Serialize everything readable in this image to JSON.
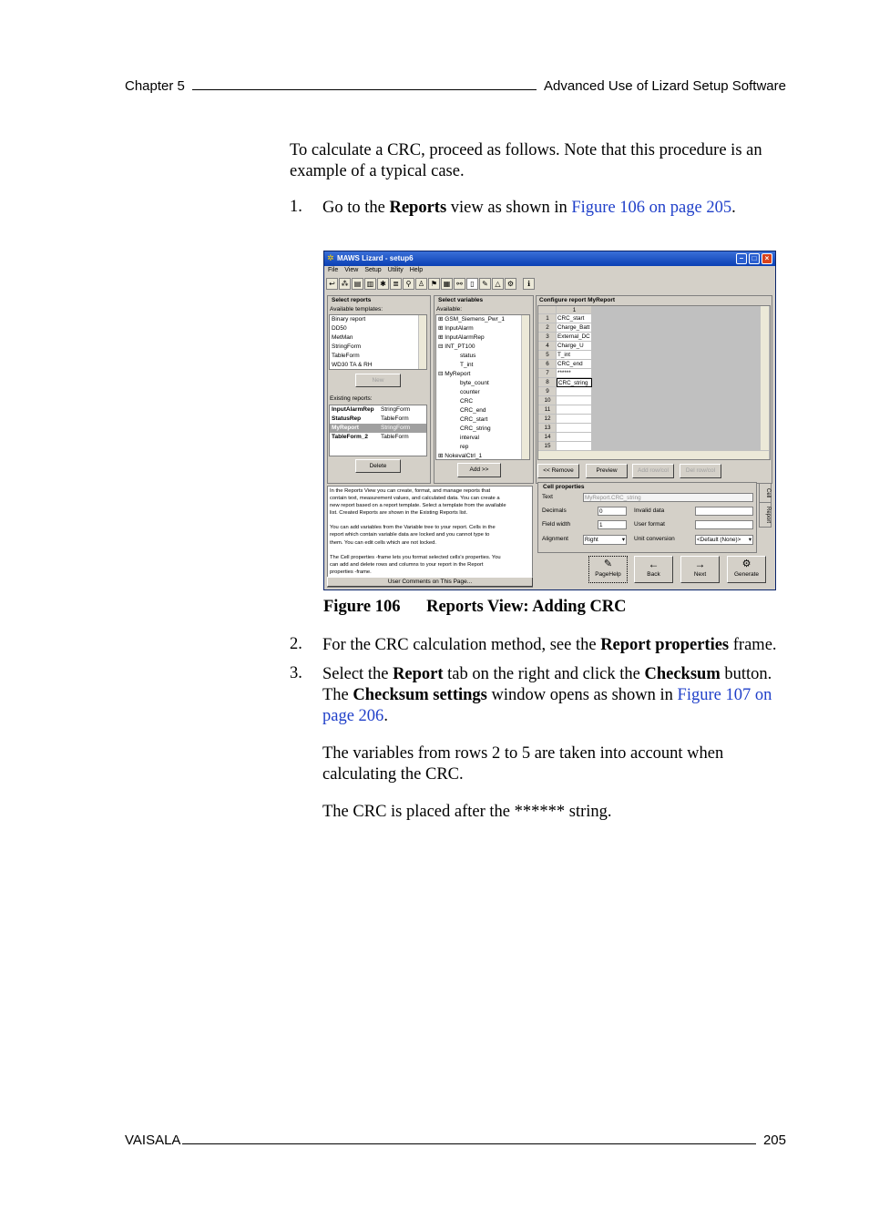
{
  "header": {
    "chapter": "Chapter 5",
    "section": "Advanced Use of Lizard Setup Software"
  },
  "intro": "To calculate a CRC, proceed as follows. Note that this procedure is an example of a typical case.",
  "step1": {
    "num": "1.",
    "pre": "Go to the ",
    "bold": "Reports",
    "mid": " view as shown in ",
    "link": "Figure 106 on page 205",
    "post": "."
  },
  "figure": {
    "window_title": "MAWS Lizard - setup6",
    "menu": [
      "File",
      "View",
      "Setup",
      "Utility",
      "Help"
    ],
    "select_reports": {
      "heading": "Select reports",
      "templates_label": "Available templates:",
      "templates": [
        "Binary report",
        "DD50",
        "MetMan",
        "StringForm",
        "TableForm",
        "WD30 TA & RH"
      ],
      "new_button": "New",
      "existing_label": "Existing reports:",
      "existing": [
        {
          "name": "InputAlarmRep",
          "type": "StringForm"
        },
        {
          "name": "StatusRep",
          "type": "TableForm"
        },
        {
          "name": "MyReport",
          "type": "StringForm"
        },
        {
          "name": "TableForm_2",
          "type": "TableForm"
        }
      ],
      "delete_button": "Delete"
    },
    "select_variables": {
      "heading": "Select variables",
      "available_label": "Available:",
      "tree": [
        "GSM_Siemens_Pwr_1",
        "InputAlarm",
        "InputAlarmRep",
        "INT_PT100",
        "status",
        "T_int",
        "MyReport",
        "byte_count",
        "counter",
        "CRC",
        "CRC_end",
        "CRC_start",
        "CRC_string",
        "interval",
        "rep",
        "NokevalCtrl_1"
      ],
      "add_button": "Add >>"
    },
    "configure": {
      "heading": "Configure report MyReport",
      "col_header": "1",
      "rows": [
        "1",
        "2",
        "3",
        "4",
        "5",
        "6",
        "7",
        "8",
        "9",
        "10",
        "11",
        "12",
        "13",
        "14",
        "15"
      ],
      "cells": [
        "CRC_start",
        "Charge_Batt",
        "External_DC",
        "Charge_U",
        "T_int",
        "CRC_end",
        "******",
        "CRC_string",
        "",
        "",
        "",
        "",
        "",
        "",
        ""
      ],
      "buttons": [
        "<< Remove",
        "Preview",
        "Add row/col",
        "Del row/col"
      ]
    },
    "help_text": [
      "In the Reports View you can create, format, and manage reports that",
      "contain text, measurement values, and calculated data. You can create a",
      "new report based on a report template. Select a template from the available",
      "list. Created Reports are shown in the Existing Reports list.",
      "",
      "You can add variables from the Variable tree to your report. Cells in the",
      "report which contain variable data are locked and you cannot type to",
      "them. You can edit cells which are not locked.",
      "",
      "The Cell properties -frame lets you format selected cells's properties. You",
      "can add and delete rows and columns to your report in the Report",
      "properties -frame."
    ],
    "user_comments": "User Comments on This Page...",
    "cell_properties": {
      "heading": "Cell properties",
      "text_label": "Text",
      "text_value": "MyReport.CRC_string",
      "decimals_label": "Decimals",
      "decimals_value": "0",
      "field_width_label": "Field width",
      "field_width_value": "1",
      "alignment_label": "Alignment",
      "alignment_value": "Right",
      "invalid_data_label": "Invalid data",
      "user_format_label": "User format",
      "unit_conversion_label": "Unit conversion",
      "unit_conversion_value": "<Default (None)>",
      "tabs": [
        "Cell",
        "Report"
      ]
    },
    "nav_buttons": [
      "PageHelp",
      "Back",
      "Next",
      "Generate"
    ]
  },
  "caption": {
    "num": "Figure 106",
    "title": "Reports View: Adding CRC"
  },
  "step2": {
    "num": "2.",
    "pre": "For the CRC calculation method, see the ",
    "bold": "Report properties",
    "post": " frame."
  },
  "step3": {
    "num": "3.",
    "a": "Select the ",
    "b": "Report",
    "c": " tab on the right and click the ",
    "d": "Checksum",
    "e": " button.",
    "f": "The ",
    "g": "Checksum settings",
    "h": " window opens as shown in ",
    "link1": "Figure 107 on",
    "link2": "page 206",
    "i": "."
  },
  "note1": "The variables from rows 2 to 5 are taken into account when calculating the CRC.",
  "note2": "The CRC is placed after the ****** string.",
  "footer": {
    "company": "VAISALA",
    "page": "205"
  }
}
